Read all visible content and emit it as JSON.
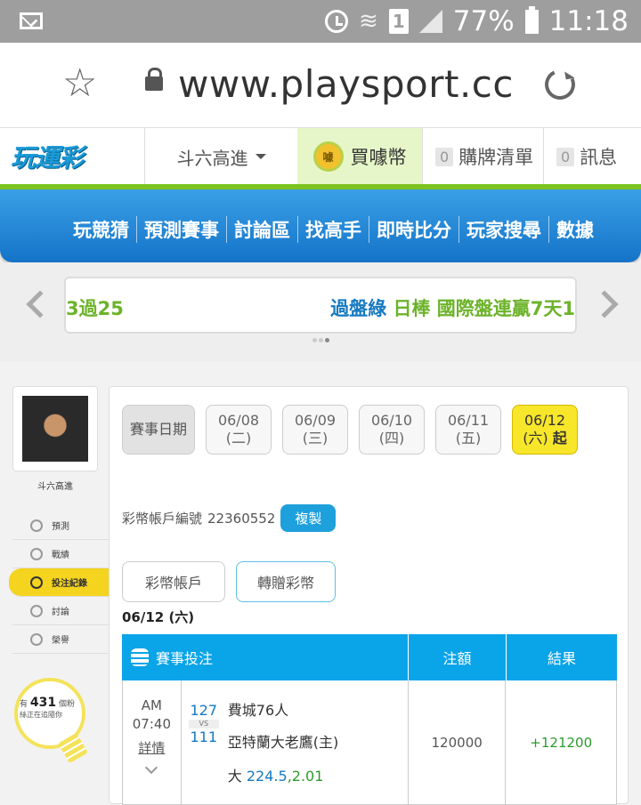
{
  "status": {
    "battery": "77%",
    "time": "11:18",
    "sim": "1"
  },
  "browser": {
    "url": "www.playsport.cc"
  },
  "site": {
    "logo": "玩運彩",
    "user_dropdown": "斗六高進",
    "buy_coin": "買噱幣",
    "coin_icon_text": "噱",
    "cart_count": "0",
    "cart_label": "購牌清單",
    "msg_count": "0",
    "msg_label": "訊息"
  },
  "nav": [
    "玩競猜",
    "預測賽事",
    "討論區",
    "找高手",
    "即時比分",
    "玩家搜尋",
    "數據"
  ],
  "ticker": {
    "left": "3過25",
    "right_prefix": "過盤綠",
    "right_main": "日棒 國際盤連贏7天1"
  },
  "sidebar": {
    "username": "斗六高進",
    "items": [
      {
        "label": "預測"
      },
      {
        "label": "戰績"
      },
      {
        "label": "投注紀錄"
      },
      {
        "label": "討論"
      },
      {
        "label": "榮譽"
      }
    ],
    "fans_prefix": "有",
    "fans_count": "431",
    "fans_suffix": "個粉",
    "fans_line2": "絲正在追隨你"
  },
  "dates": {
    "label": "賽事日期",
    "items": [
      {
        "date": "06/08",
        "day": "(二)"
      },
      {
        "date": "06/09",
        "day": "(三)"
      },
      {
        "date": "06/10",
        "day": "(四)"
      },
      {
        "date": "06/11",
        "day": "(五)"
      },
      {
        "date": "06/12",
        "day": "(六)",
        "suffix": "起"
      }
    ]
  },
  "account": {
    "label": "彩幣帳戶編號",
    "number": "22360552",
    "copy": "複製"
  },
  "tabs": {
    "wallet": "彩幣帳戶",
    "transfer": "轉贈彩幣"
  },
  "day_header": "06/12 (六)",
  "table": {
    "headers": {
      "game": "賽事投注",
      "amount": "注額",
      "result": "結果"
    },
    "rows": [
      {
        "ampm": "AM",
        "time": "07:40",
        "detail": "詳情",
        "score_away": "127",
        "vs": "VS",
        "score_home": "111",
        "team_away": "費城76人",
        "team_home": "亞特蘭大老鷹(主)",
        "pick_side": "大",
        "pick_line": "224.5",
        "pick_odds": ",2.01",
        "amount": "120000",
        "result": "+121200"
      }
    ]
  }
}
